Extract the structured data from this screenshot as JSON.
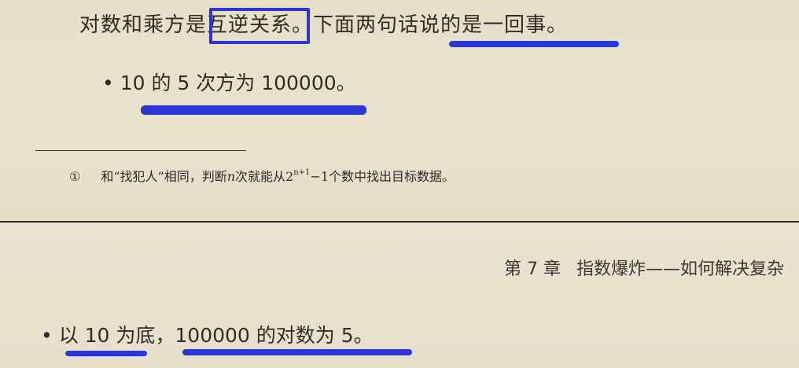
{
  "top_page": {
    "line1": {
      "prefix": "对数和乘方是",
      "boxed_term": "互逆关系",
      "suffix": "。下面两句话说的是一回事。"
    },
    "bullet1": "• 10 的 5 次方为 100000。",
    "footnote": {
      "mark": "①",
      "text_before": "和“找犯人”相同，判断",
      "var_n": "n",
      "text_mid": "次就能从2",
      "superscript": "n+1",
      "text_after": "−1个数中找出目标数据。"
    }
  },
  "bottom_page": {
    "chapter_number": "第 7 章",
    "chapter_title": "指数爆炸——如何解决复杂",
    "bullet2": "• 以 10 为底，100000 的对数为 5。"
  },
  "colors": {
    "annotation": "#2c36d6",
    "paper": "#e7e1cc",
    "divider": "#2a2823"
  }
}
